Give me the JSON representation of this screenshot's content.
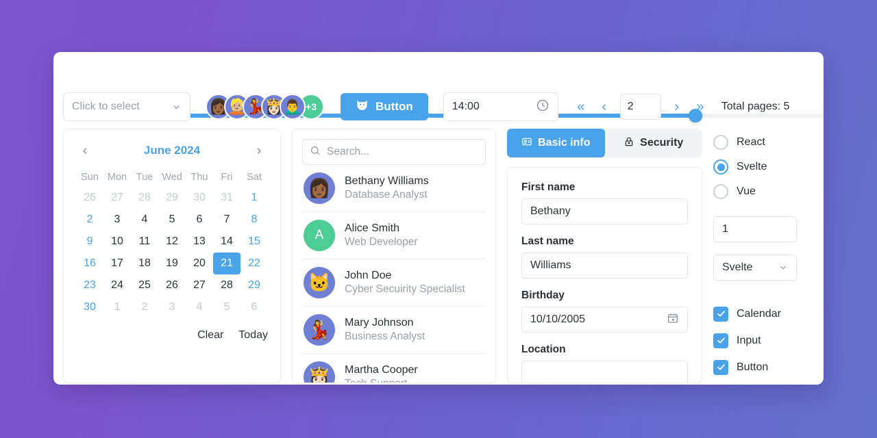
{
  "background": {
    "from": "#7b57cc",
    "to": "#6370cb"
  },
  "accent": "#4aa3e8",
  "green": "#4dcc96",
  "slider": {
    "name": "progress-slider",
    "value": 77,
    "min": 0,
    "max": 100
  },
  "toolbar": {
    "select_placeholder": "Click to select",
    "avatars": [
      {
        "emoji": "👩🏾"
      },
      {
        "emoji": "👱🏼"
      },
      {
        "emoji": "💃"
      },
      {
        "emoji": "👸🏻"
      },
      {
        "emoji": "🙍‍♂️"
      }
    ],
    "avatar_more": "+3",
    "button_label": "Button",
    "button_icon": "cat-icon",
    "time_value": "14:00",
    "time_icon": "clock-icon",
    "pager": {
      "first_label": "«",
      "prev_label": "‹",
      "page_value": "2",
      "next_label": "›",
      "last_label": "»",
      "total_label": "Total pages: 5"
    }
  },
  "calendar": {
    "prev_label": "‹",
    "title": "June 2024",
    "next_label": "›",
    "dow": [
      "Sun",
      "Mon",
      "Tue",
      "Wed",
      "Thu",
      "Fri",
      "Sat"
    ],
    "days": [
      {
        "d": "26",
        "muted": true
      },
      {
        "d": "27",
        "muted": true
      },
      {
        "d": "28",
        "muted": true
      },
      {
        "d": "29",
        "muted": true
      },
      {
        "d": "30",
        "muted": true
      },
      {
        "d": "31",
        "muted": true
      },
      {
        "d": "1",
        "weekend": true
      },
      {
        "d": "2",
        "weekend": true
      },
      {
        "d": "3"
      },
      {
        "d": "4"
      },
      {
        "d": "5"
      },
      {
        "d": "6"
      },
      {
        "d": "7"
      },
      {
        "d": "8",
        "weekend": true
      },
      {
        "d": "9",
        "weekend": true
      },
      {
        "d": "10"
      },
      {
        "d": "11"
      },
      {
        "d": "12"
      },
      {
        "d": "13"
      },
      {
        "d": "14"
      },
      {
        "d": "15",
        "weekend": true
      },
      {
        "d": "16",
        "weekend": true
      },
      {
        "d": "17"
      },
      {
        "d": "18"
      },
      {
        "d": "19"
      },
      {
        "d": "20"
      },
      {
        "d": "21",
        "selected": true
      },
      {
        "d": "22",
        "weekend": true
      },
      {
        "d": "23",
        "weekend": true
      },
      {
        "d": "24"
      },
      {
        "d": "25"
      },
      {
        "d": "26"
      },
      {
        "d": "27"
      },
      {
        "d": "28"
      },
      {
        "d": "29",
        "weekend": true
      },
      {
        "d": "30",
        "weekend": true
      },
      {
        "d": "1",
        "muted": true
      },
      {
        "d": "2",
        "muted": true
      },
      {
        "d": "3",
        "muted": true
      },
      {
        "d": "4",
        "muted": true
      },
      {
        "d": "5",
        "muted": true
      },
      {
        "d": "6",
        "muted": true
      }
    ],
    "clear_label": "Clear",
    "today_label": "Today"
  },
  "contacts": {
    "search_placeholder": "Search...",
    "items": [
      {
        "name": "Bethany Williams",
        "role": "Database Analyst",
        "avatar": "👩🏾",
        "type": "emoji"
      },
      {
        "name": "Alice Smith",
        "role": "Web Developer",
        "avatar": "A",
        "type": "letter"
      },
      {
        "name": "John Doe",
        "role": "Cyber Secuirity Specialist",
        "avatar": "🐱",
        "type": "emoji"
      },
      {
        "name": "Mary Johnson",
        "role": "Business Analyst",
        "avatar": "💃",
        "type": "emoji"
      },
      {
        "name": "Martha Cooper",
        "role": "Tech Support",
        "avatar": "👸🏻",
        "type": "emoji"
      }
    ]
  },
  "form": {
    "tabs": [
      {
        "label": "Basic info",
        "icon": "id-card-icon",
        "active": true
      },
      {
        "label": "Security",
        "icon": "lock-icon",
        "active": false
      }
    ],
    "fields": [
      {
        "label": "First name",
        "value": "Bethany"
      },
      {
        "label": "Last name",
        "value": "Williams"
      },
      {
        "label": "Birthday",
        "value": "10/10/2005",
        "icon": "calendar-icon"
      },
      {
        "label": "Location",
        "value": ""
      }
    ]
  },
  "controls": {
    "radios": [
      {
        "label": "React",
        "checked": false
      },
      {
        "label": "Svelte",
        "checked": true
      },
      {
        "label": "Vue",
        "checked": false
      }
    ],
    "number_value": "1",
    "select_value": "Svelte",
    "checkboxes": [
      {
        "label": "Calendar",
        "checked": true
      },
      {
        "label": "Input",
        "checked": true
      },
      {
        "label": "Button",
        "checked": true
      }
    ]
  }
}
